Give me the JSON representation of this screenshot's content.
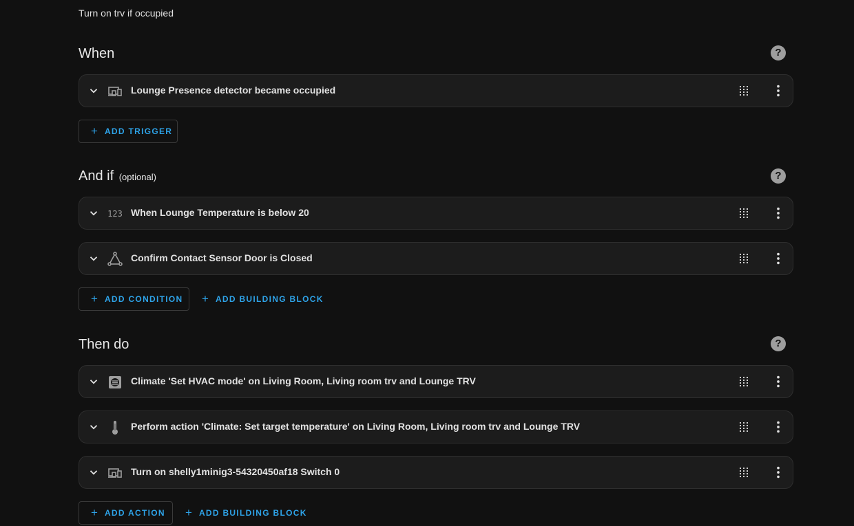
{
  "automation": {
    "description": "Turn on trv if occupied"
  },
  "when": {
    "title": "When",
    "help_icon": "help-circle-icon",
    "items": [
      {
        "icon": "devices-icon",
        "label": "Lounge Presence detector became occupied"
      }
    ],
    "add_trigger_label": "ADD TRIGGER"
  },
  "and_if": {
    "title": "And if",
    "optional_label": "(optional)",
    "help_icon": "help-circle-icon",
    "items": [
      {
        "icon": "numeric-icon",
        "icon_text": "123",
        "label": "When Lounge Temperature is below 20"
      },
      {
        "icon": "state-graph-icon",
        "label": "Confirm Contact Sensor Door is Closed"
      }
    ],
    "add_condition_label": "ADD CONDITION",
    "add_building_block_label": "ADD BUILDING BLOCK"
  },
  "then_do": {
    "title": "Then do",
    "help_icon": "help-circle-icon",
    "items": [
      {
        "icon": "climate-service-icon",
        "label": "Climate 'Set HVAC mode' on Living Room, Living room trv and Lounge TRV"
      },
      {
        "icon": "thermometer-icon",
        "label": "Perform action 'Climate: Set target temperature' on Living Room, Living room trv and Lounge TRV"
      },
      {
        "icon": "devices-icon",
        "label": "Turn on shelly1minig3-54320450af18 Switch 0"
      }
    ],
    "add_action_label": "ADD ACTION",
    "add_building_block_label": "ADD BUILDING BLOCK"
  },
  "colors": {
    "background": "#111111",
    "card": "#1c1c1c",
    "accent": "#2ea3e8",
    "icon": "#9e9e9e"
  },
  "help_glyph": "?",
  "plus_glyph": "+"
}
